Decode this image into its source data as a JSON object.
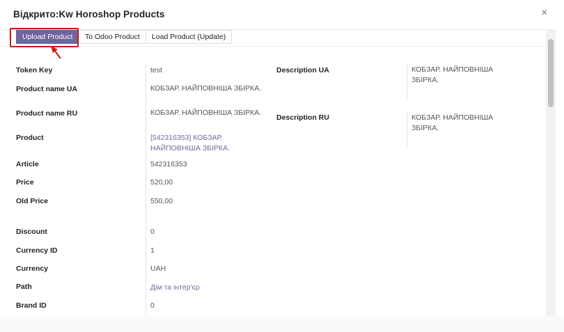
{
  "dialog": {
    "title": "Відкрито:Kw Horoshop Products",
    "close_label": "×"
  },
  "toolbar": {
    "upload_label": "Upload Product",
    "odoo_label": "To Odoo Product",
    "load_label": "Load Product (Update)"
  },
  "fields": {
    "token_key": {
      "label": "Token Key",
      "value": "test"
    },
    "product_name_ua": {
      "label": "Product name UA",
      "value": "КОБЗАР. НАЙПОВНІША ЗБІРКА."
    },
    "product_name_ru": {
      "label": "Product name RU",
      "value": "КОБЗАР. НАЙПОВНІША ЗБІРКА."
    },
    "product": {
      "label": "Product",
      "value": "[542316353] КОБЗАР. НАЙПОВНІША ЗБІРКА."
    },
    "article": {
      "label": "Article",
      "value": "542316353"
    },
    "price": {
      "label": "Price",
      "value": "520,00"
    },
    "old_price": {
      "label": "Old Price",
      "value": "550,00"
    },
    "discount": {
      "label": "Discount",
      "value": "0"
    },
    "currency_id": {
      "label": "Currency ID",
      "value": "1"
    },
    "currency": {
      "label": "Currency",
      "value": "UAH"
    },
    "path": {
      "label": "Path",
      "value": "Дім та інтер'єр"
    },
    "brand_id": {
      "label": "Brand ID",
      "value": "0"
    },
    "description_ua": {
      "label": "Description UA",
      "value": "КОБЗАР. НАЙПОВНІША ЗБІРКА."
    },
    "description_ru": {
      "label": "Description RU",
      "value": "КОБЗАР. НАЙПОВНІША ЗБІРКА."
    }
  },
  "colors": {
    "primary": "#71639e",
    "highlight": "#c91a1a"
  }
}
